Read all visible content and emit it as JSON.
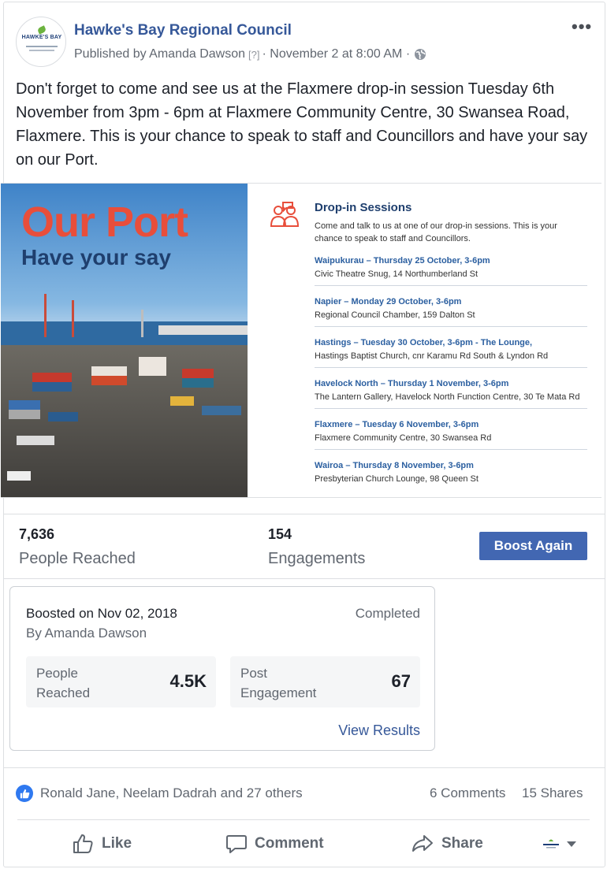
{
  "post": {
    "page_name": "Hawke's Bay Regional Council",
    "published_by": "Published by Amanda Dawson",
    "help_marker": "[?]",
    "separator": "·",
    "date": "November 2 at 8:00 AM",
    "privacy_icon": "globe-icon",
    "more_icon": "more-options-icon",
    "more_label": "•••",
    "avatar_text": "HAWKE'S BAY",
    "text": "Don't forget to come and see us at the Flaxmere drop-in session Tuesday 6th November from 3pm - 6pm at Flaxmere Community Centre, 30 Swansea Road, Flaxmere. This is your chance to speak to staff and Councillors and have your say on our Port."
  },
  "image": {
    "title": "Our Port",
    "subtitle": "Have your say",
    "sessions_title": "Drop-in Sessions",
    "sessions_intro": "Come and talk to us at one of our drop-in sessions. This is your chance to speak to staff and Councillors.",
    "sessions": [
      {
        "title": "Waipukurau – Thursday 25 October, 3-6pm",
        "place": "Civic Theatre Snug, 14 Northumberland St"
      },
      {
        "title": "Napier – Monday 29 October, 3-6pm",
        "place": "Regional Council Chamber, 159 Dalton St"
      },
      {
        "title": "Hastings – Tuesday 30 October, 3-6pm - The Lounge,",
        "place": "Hastings Baptist Church, cnr Karamu Rd South & Lyndon Rd"
      },
      {
        "title": "Havelock North – Thursday 1 November, 3-6pm",
        "place": "The Lantern Gallery, Havelock North Function Centre, 30 Te Mata Rd"
      },
      {
        "title": "Flaxmere – Tuesday 6 November, 3-6pm",
        "place": "Flaxmere Community Centre, 30 Swansea Rd"
      },
      {
        "title": "Wairoa – Thursday 8 November, 3-6pm",
        "place": "Presbyterian Church Lounge, 98 Queen St"
      }
    ]
  },
  "stats": {
    "reached_value": "7,636",
    "reached_label": "People Reached",
    "engagements_value": "154",
    "engagements_label": "Engagements",
    "boost_button": "Boost Again"
  },
  "boost": {
    "date": "Boosted on Nov 02, 2018",
    "by": "By Amanda Dawson",
    "status": "Completed",
    "metric1_label": "People Reached",
    "metric1_value": "4.5K",
    "metric2_label": "Post Engagement",
    "metric2_value": "67",
    "view_results": "View Results"
  },
  "reactions": {
    "icon": "like-reaction-icon",
    "names": "Ronald Jane, Neelam Dadrah and 27 others",
    "comments": "6 Comments",
    "shares": "15 Shares"
  },
  "actions": {
    "like": "Like",
    "comment": "Comment",
    "share": "Share",
    "switcher_icon": "page-avatar-icon"
  },
  "colors": {
    "link_blue": "#365899",
    "button_blue": "#4267b2",
    "port_red": "#e84e3b",
    "port_navy": "#1f3f6e",
    "secondary_text": "#616770"
  }
}
